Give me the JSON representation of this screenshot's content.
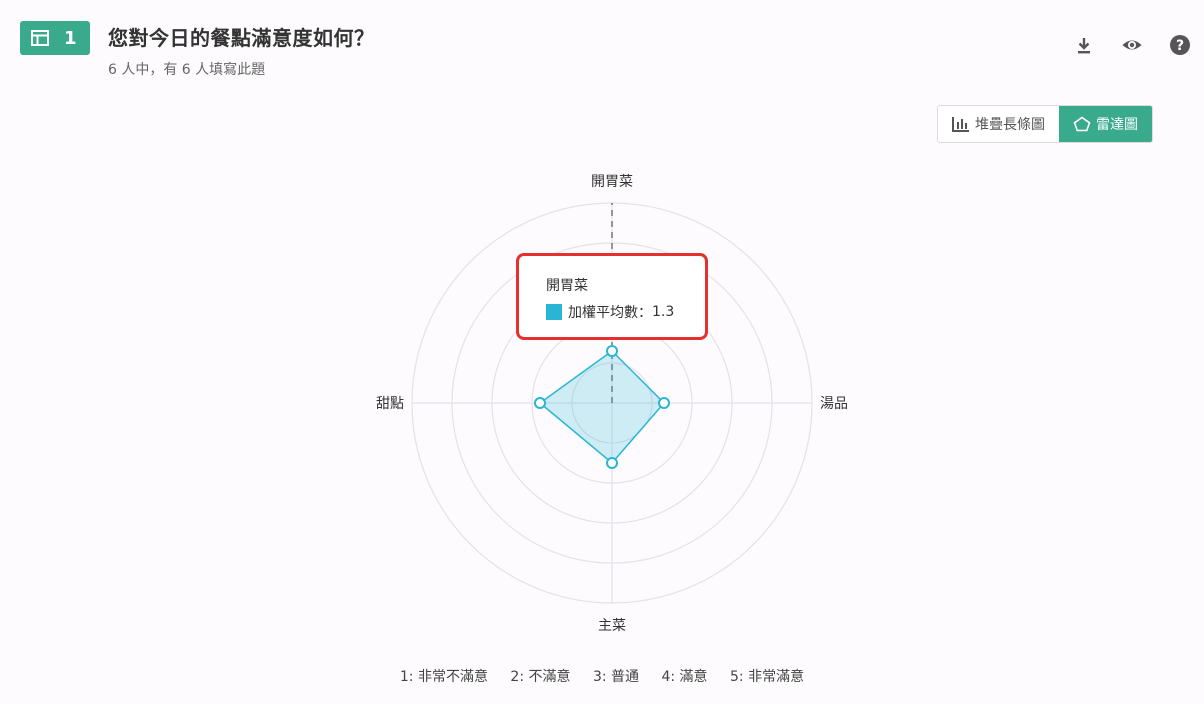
{
  "question": {
    "number": "1",
    "title": "您對今日的餐點滿意度如何？",
    "subtitle": "6 人中，有 6 人填寫此題"
  },
  "toolbar": {
    "icons": [
      "download-icon",
      "eye-icon",
      "help-icon"
    ]
  },
  "view_toggle": {
    "stacked_label": "堆疊長條圖",
    "radar_label": "雷達圖",
    "active": "radar"
  },
  "colors": {
    "accent": "#3aaa8c",
    "series": "#29b6d4",
    "highlight": "#e53030"
  },
  "chart_data": {
    "type": "radar",
    "axes": [
      "開胃菜",
      "湯品",
      "主菜",
      "甜點"
    ],
    "series": [
      {
        "name": "加權平均數",
        "values": [
          1.3,
          1.3,
          1.5,
          1.8
        ]
      }
    ],
    "rmax": 5,
    "rings": 5,
    "tooltip": {
      "axis": "開胃菜",
      "series": "加權平均數",
      "value": "1.3"
    },
    "legend": [
      "1: 非常不滿意",
      "2: 不滿意",
      "3: 普通",
      "4: 滿意",
      "5: 非常滿意"
    ]
  }
}
